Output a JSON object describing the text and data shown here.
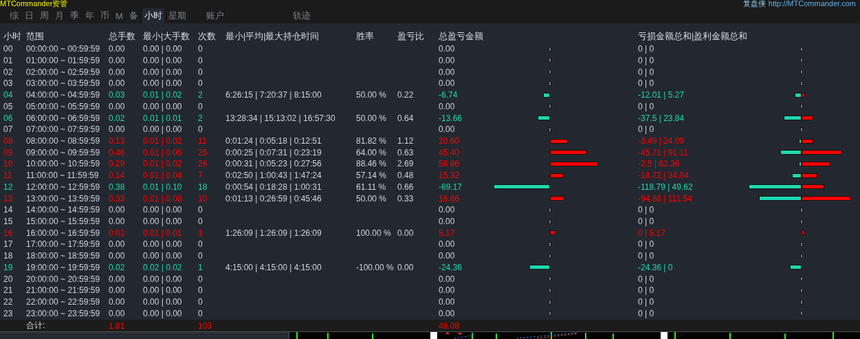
{
  "title": {
    "app": "MTCommander资管",
    "brand": "复盘侠",
    "url": "http://MTCommander.com"
  },
  "tabs": [
    {
      "label": "综",
      "selected": false
    },
    {
      "label": "日",
      "selected": false
    },
    {
      "label": "周",
      "selected": false
    },
    {
      "label": "月",
      "selected": false
    },
    {
      "label": "季",
      "selected": false
    },
    {
      "label": "年",
      "selected": false
    },
    {
      "label": "币",
      "selected": false
    },
    {
      "label": "M",
      "selected": false
    },
    {
      "label": "备",
      "selected": false
    },
    {
      "label": "小时",
      "selected": true
    },
    {
      "label": "星期",
      "selected": false
    },
    {
      "label": "账户",
      "selected": false,
      "kind": "wide"
    },
    {
      "label": "轨迹",
      "selected": false,
      "kind": "wide"
    }
  ],
  "columns": [
    "小时",
    "范围",
    "总手数",
    "最小|大手数",
    "次数",
    "最小|平均|最大持仓时间",
    "胜率",
    "盈亏比",
    "总盈亏金额",
    "亏损金额总和|盈利金额总和"
  ],
  "rows": [
    {
      "hour": "00",
      "range": "00:00:00 ~ 00:59:59",
      "lots": "0.00",
      "lot_range": "0.00 | 0.00",
      "count": "0",
      "pnl": "0.00",
      "loss_profit": "0 | 0",
      "color": "#d0d4da"
    },
    {
      "hour": "01",
      "range": "01:00:00 ~ 01:59:59",
      "lots": "0.00",
      "lot_range": "0.00 | 0.00",
      "count": "0",
      "pnl": "0.00",
      "loss_profit": "0 | 0",
      "color": "#d0d4da"
    },
    {
      "hour": "02",
      "range": "02:00:00 ~ 02:59:59",
      "lots": "0.00",
      "lot_range": "0.00 | 0.00",
      "count": "0",
      "pnl": "0.00",
      "loss_profit": "0 | 0",
      "color": "#d0d4da"
    },
    {
      "hour": "03",
      "range": "03:00:00 ~ 03:59:59",
      "lots": "0.00",
      "lot_range": "0.00 | 0.00",
      "count": "0",
      "pnl": "0.00",
      "loss_profit": "0 | 0",
      "color": "#d0d4da"
    },
    {
      "hour": "04",
      "range": "04:00:00 ~ 04:59:59",
      "lots": "0.03",
      "lot_range": "0.01 | 0.02",
      "count": "2",
      "hold": "6:26:15 | 7:20:37 | 8:15:00",
      "win_rate": "50.00 %",
      "ratio": "0.22",
      "pnl": "-6.74",
      "loss_profit": "-12.01 | 5.27",
      "color": "#1ed7b0"
    },
    {
      "hour": "05",
      "range": "05:00:00 ~ 05:59:59",
      "lots": "0.00",
      "lot_range": "0.00 | 0.00",
      "count": "0",
      "pnl": "0.00",
      "loss_profit": "0 | 0",
      "color": "#d0d4da"
    },
    {
      "hour": "06",
      "range": "06:00:00 ~ 06:59:59",
      "lots": "0.02",
      "lot_range": "0.01 | 0.01",
      "count": "2",
      "hold": "13:28:34 | 15:13:02 | 16:57:30",
      "win_rate": "50.00 %",
      "ratio": "0.64",
      "pnl": "-13.66",
      "loss_profit": "-37.5 | 23.84",
      "color": "#1ed7b0"
    },
    {
      "hour": "07",
      "range": "07:00:00 ~ 07:59:59",
      "lots": "0.00",
      "lot_range": "0.00 | 0.00",
      "count": "0",
      "pnl": "0.00",
      "loss_profit": "0 | 0",
      "color": "#d0d4da"
    },
    {
      "hour": "08",
      "range": "08:00:00 ~ 08:59:59",
      "lots": "0.13",
      "lot_range": "0.01 | 0.02",
      "count": "11",
      "hold": "0:01:24 | 0:05:18 | 0:12:51",
      "win_rate": "81.82 %",
      "ratio": "1.12",
      "pnl": "20.60",
      "loss_profit": "-3.49 | 24.09",
      "color": "#ff0000"
    },
    {
      "hour": "09",
      "range": "09:00:00 ~ 09:59:59",
      "lots": "0.46",
      "lot_range": "0.01 | 0.06",
      "count": "25",
      "hold": "0:00:25 | 0:07:31 | 0:23:19",
      "win_rate": "64.00 %",
      "ratio": "0.63",
      "pnl": "45.40",
      "loss_profit": "-45.71 | 91.11",
      "color": "#ff0000"
    },
    {
      "hour": "10",
      "range": "10:00:00 ~ 10:59:59",
      "lots": "0.29",
      "lot_range": "0.01 | 0.02",
      "count": "26",
      "hold": "0:00:31 | 0:05:23 | 0:27:56",
      "win_rate": "88.46 %",
      "ratio": "2.69",
      "pnl": "58.86",
      "loss_profit": "-2.5 | 61.36",
      "color": "#ff0000"
    },
    {
      "hour": "11",
      "range": "11:00:00 ~ 11:59:59",
      "lots": "0.14",
      "lot_range": "0.01 | 0.04",
      "count": "7",
      "hold": "0:02:50 | 1:00:43 | 1:47:24",
      "win_rate": "57.14 %",
      "ratio": "0.48",
      "pnl": "15.32",
      "loss_profit": "-18.72 | 34.04",
      "color": "#ff0000"
    },
    {
      "hour": "12",
      "range": "12:00:00 ~ 12:59:59",
      "lots": "0.38",
      "lot_range": "0.01 | 0.10",
      "count": "18",
      "hold": "0:00:54 | 0:18:28 | 1:00:31",
      "win_rate": "61.11 %",
      "ratio": "0.66",
      "pnl": "-69.17",
      "loss_profit": "-118.79 | 49.62",
      "color": "#1ed7b0"
    },
    {
      "hour": "13",
      "range": "13:00:00 ~ 13:59:59",
      "lots": "0.33",
      "lot_range": "0.01 | 0.08",
      "count": "10",
      "hold": "0:01:13 | 0:26:59 | 0:45:46",
      "win_rate": "50.00 %",
      "ratio": "0.33",
      "pnl": "16.66",
      "loss_profit": "-94.88 | 111.54",
      "color": "#ff0000"
    },
    {
      "hour": "14",
      "range": "14:00:00 ~ 14:59:59",
      "lots": "0.00",
      "lot_range": "0.00 | 0.00",
      "count": "0",
      "pnl": "0.00",
      "loss_profit": "0 | 0",
      "color": "#d0d4da"
    },
    {
      "hour": "15",
      "range": "15:00:00 ~ 15:59:59",
      "lots": "0.00",
      "lot_range": "0.00 | 0.00",
      "count": "0",
      "pnl": "0.00",
      "loss_profit": "0 | 0",
      "color": "#d0d4da"
    },
    {
      "hour": "16",
      "range": "16:00:00 ~ 16:59:59",
      "lots": "0.01",
      "lot_range": "0.01 | 0.01",
      "count": "1",
      "hold": "1:26:09 | 1:26:09 | 1:26:09",
      "win_rate": "100.00 %",
      "ratio": "0.00",
      "pnl": "5.17",
      "loss_profit": "0 | 5.17",
      "color": "#ff0000"
    },
    {
      "hour": "17",
      "range": "17:00:00 ~ 17:59:59",
      "lots": "0.00",
      "lot_range": "0.00 | 0.00",
      "count": "0",
      "pnl": "0.00",
      "loss_profit": "0 | 0",
      "color": "#d0d4da"
    },
    {
      "hour": "18",
      "range": "18:00:00 ~ 18:59:59",
      "lots": "0.00",
      "lot_range": "0.00 | 0.00",
      "count": "0",
      "pnl": "0.00",
      "loss_profit": "0 | 0",
      "color": "#d0d4da"
    },
    {
      "hour": "19",
      "range": "19:00:00 ~ 19:59:59",
      "lots": "0.02",
      "lot_range": "0.02 | 0.02",
      "count": "1",
      "hold": "4:15:00 | 4:15:00 | 4:15:00",
      "win_rate": "-100.00 %",
      "ratio": "0.00",
      "pnl": "-24.36",
      "loss_profit": "-24.36 | 0",
      "color": "#1ed7b0"
    },
    {
      "hour": "20",
      "range": "20:00:00 ~ 20:59:59",
      "lots": "0.00",
      "lot_range": "0.00 | 0.00",
      "count": "0",
      "pnl": "0.00",
      "loss_profit": "0 | 0",
      "color": "#d0d4da"
    },
    {
      "hour": "21",
      "range": "21:00:00 ~ 21:59:59",
      "lots": "0.00",
      "lot_range": "0.00 | 0.00",
      "count": "0",
      "pnl": "0.00",
      "loss_profit": "0 | 0",
      "color": "#d0d4da"
    },
    {
      "hour": "22",
      "range": "22:00:00 ~ 22:59:59",
      "lots": "0.00",
      "lot_range": "0.00 | 0.00",
      "count": "0",
      "pnl": "0.00",
      "loss_profit": "0 | 0",
      "color": "#d0d4da"
    },
    {
      "hour": "23",
      "range": "23:00:00 ~ 23:59:59",
      "lots": "0.00",
      "lot_range": "0.00 | 0.00",
      "count": "0",
      "pnl": "0.00",
      "loss_profit": "0 | 0",
      "color": "#d0d4da"
    }
  ],
  "totals": {
    "label": "合计:",
    "lots": "1.81",
    "count": "103",
    "pnl": "48.08"
  }
}
